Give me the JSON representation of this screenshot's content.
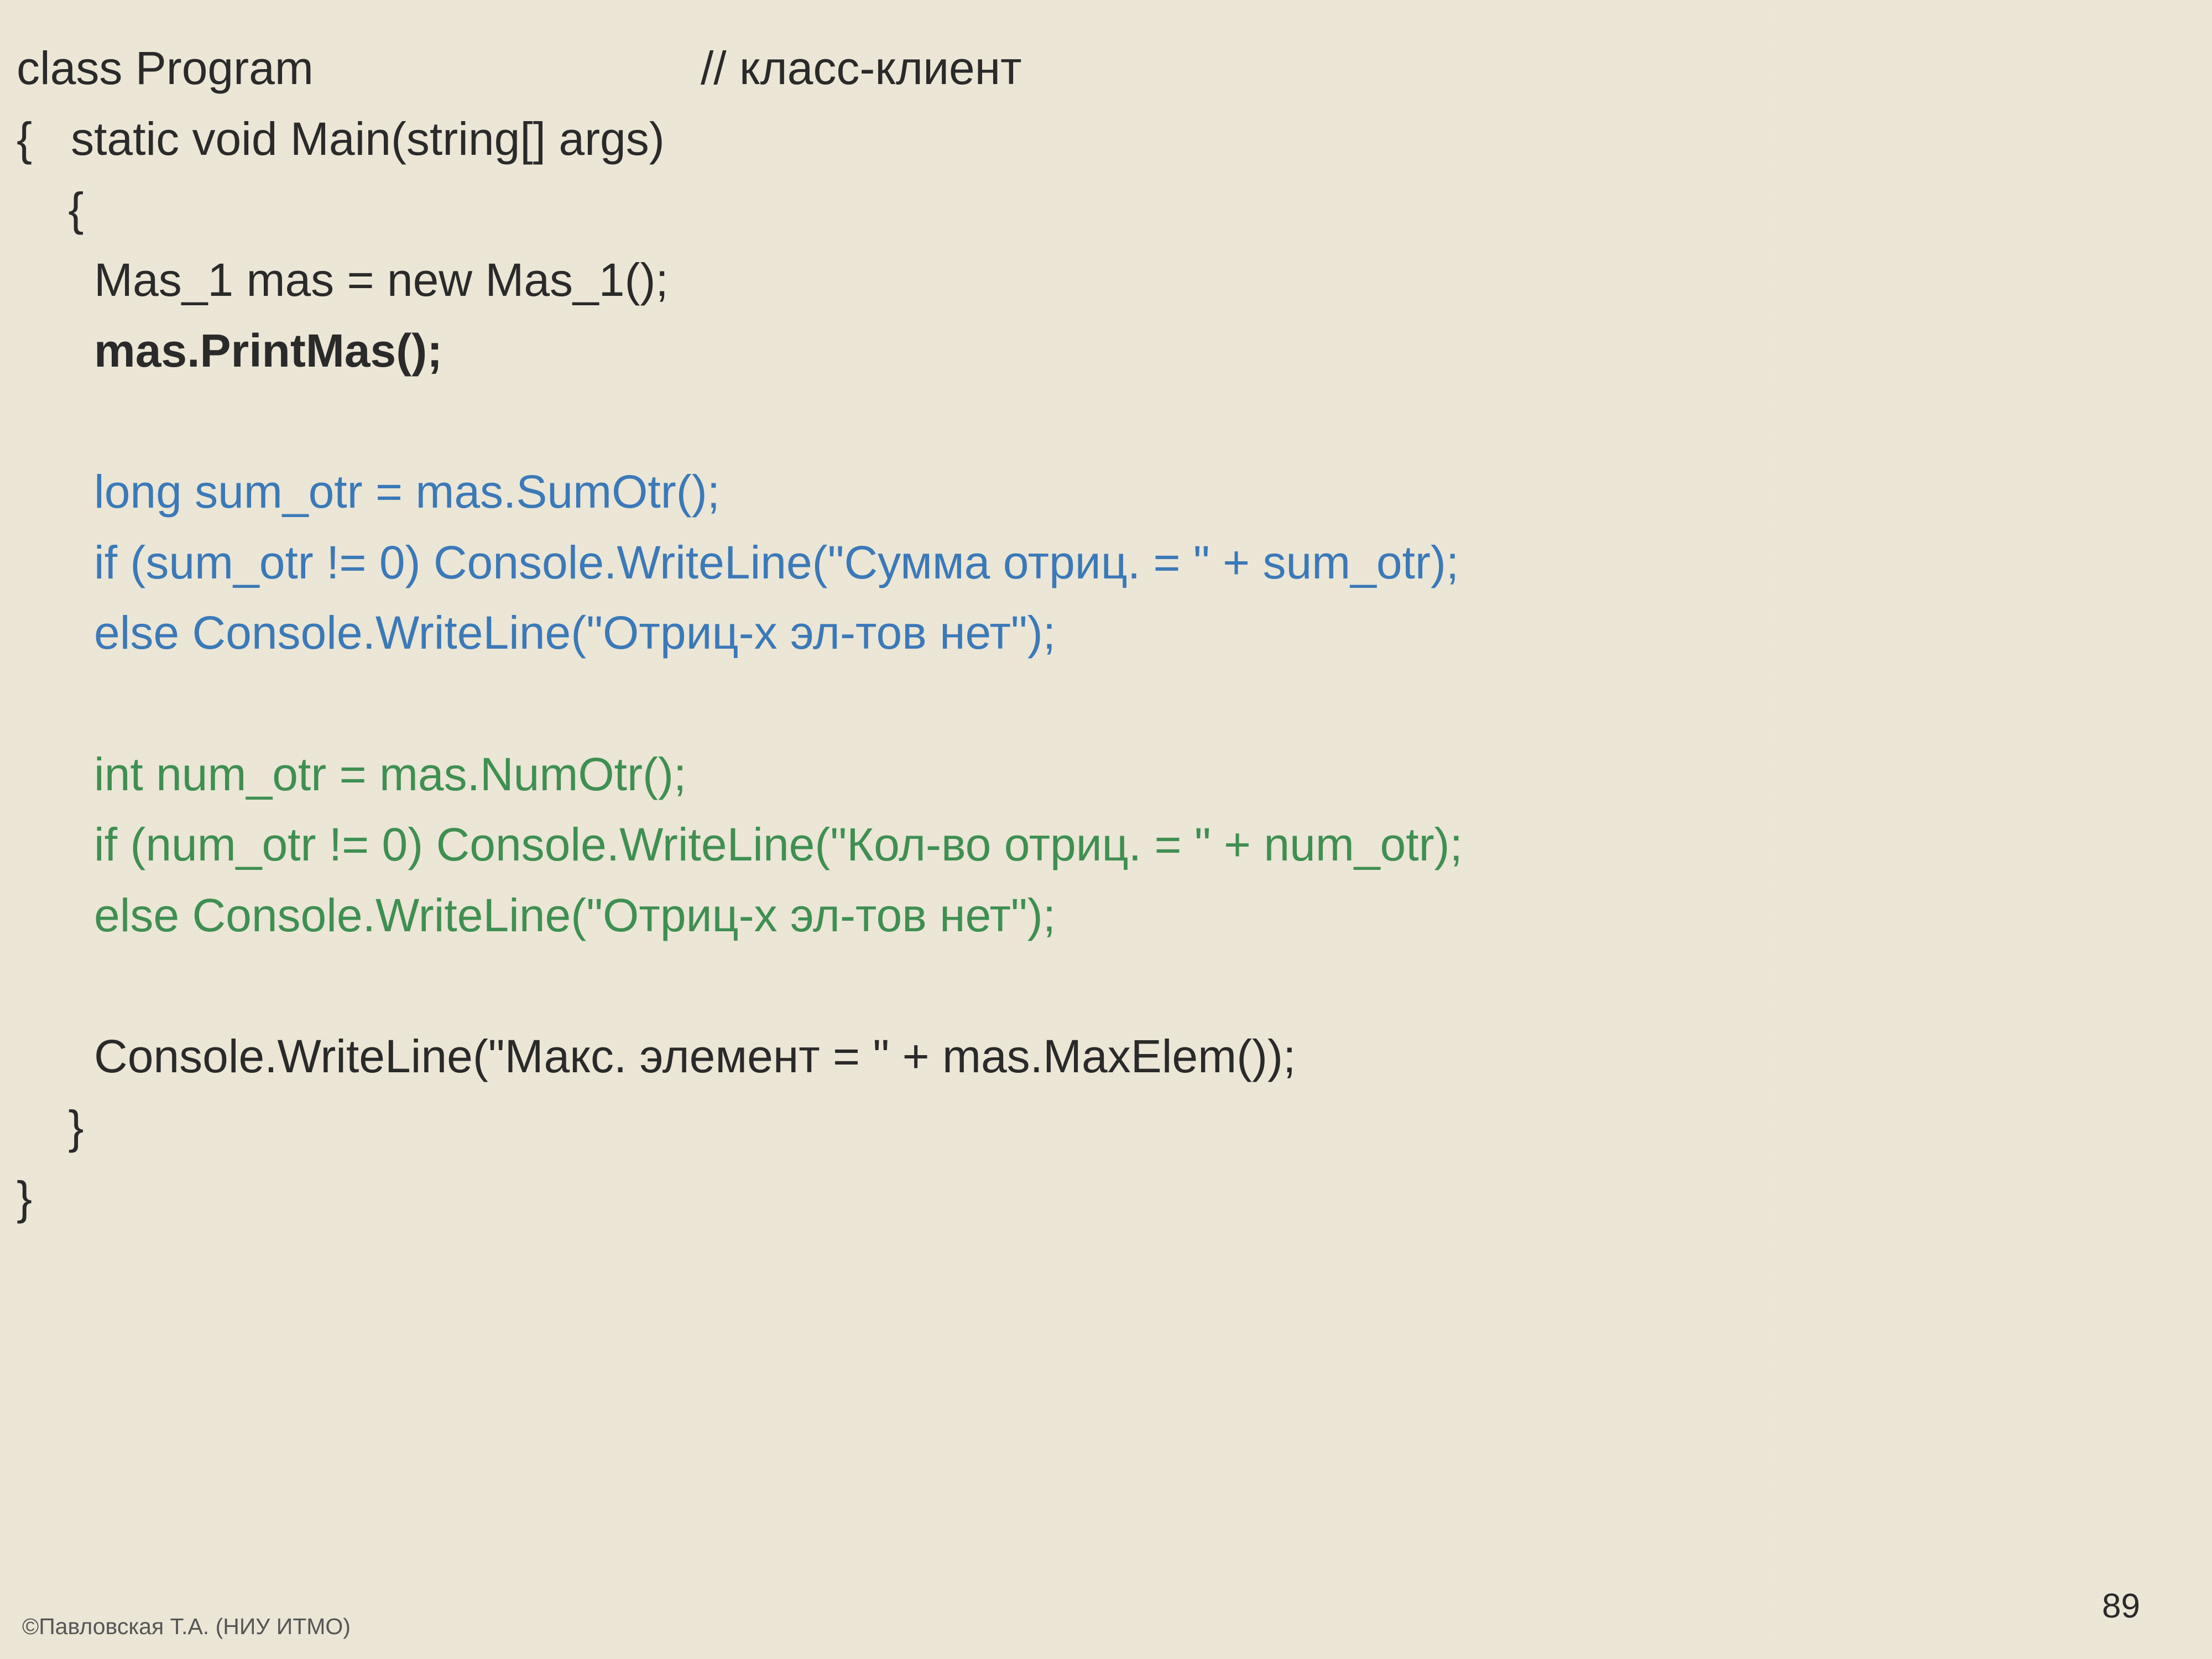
{
  "code": {
    "lines": [
      {
        "style": "c-black",
        "text": "class Program                              // класс-клиент"
      },
      {
        "style": "c-black",
        "text": "{   static void Main(string[] args)"
      },
      {
        "style": "c-black",
        "text": "    {"
      },
      {
        "style": "c-black",
        "text": "      Mas_1 mas = new Mas_1();"
      },
      {
        "style": "c-black bold",
        "text": "      mas.PrintMas();"
      },
      {
        "style": "c-black",
        "text": ""
      },
      {
        "style": "c-blue",
        "text": "      long sum_otr = mas.SumOtr();"
      },
      {
        "style": "c-blue",
        "text": "      if (sum_otr != 0) Console.WriteLine(\"Сумма отриц. = \" + sum_otr);"
      },
      {
        "style": "c-blue",
        "text": "      else Console.WriteLine(\"Отриц-х эл-тов нет\");"
      },
      {
        "style": "c-black",
        "text": ""
      },
      {
        "style": "c-green",
        "text": "      int num_otr = mas.NumOtr();"
      },
      {
        "style": "c-green",
        "text": "      if (num_otr != 0) Console.WriteLine(\"Кол-во отриц. = \" + num_otr);"
      },
      {
        "style": "c-green",
        "text": "      else Console.WriteLine(\"Отриц-х эл-тов нет\");"
      },
      {
        "style": "c-black",
        "text": ""
      },
      {
        "style": "c-black",
        "text": "      Console.WriteLine(\"Макс. элемент = \" + mas.MaxElem());"
      },
      {
        "style": "c-black",
        "text": "    }"
      },
      {
        "style": "c-black",
        "text": "}"
      }
    ]
  },
  "footer": "©Павловская Т.А. (НИУ ИТМО)",
  "page": "89"
}
